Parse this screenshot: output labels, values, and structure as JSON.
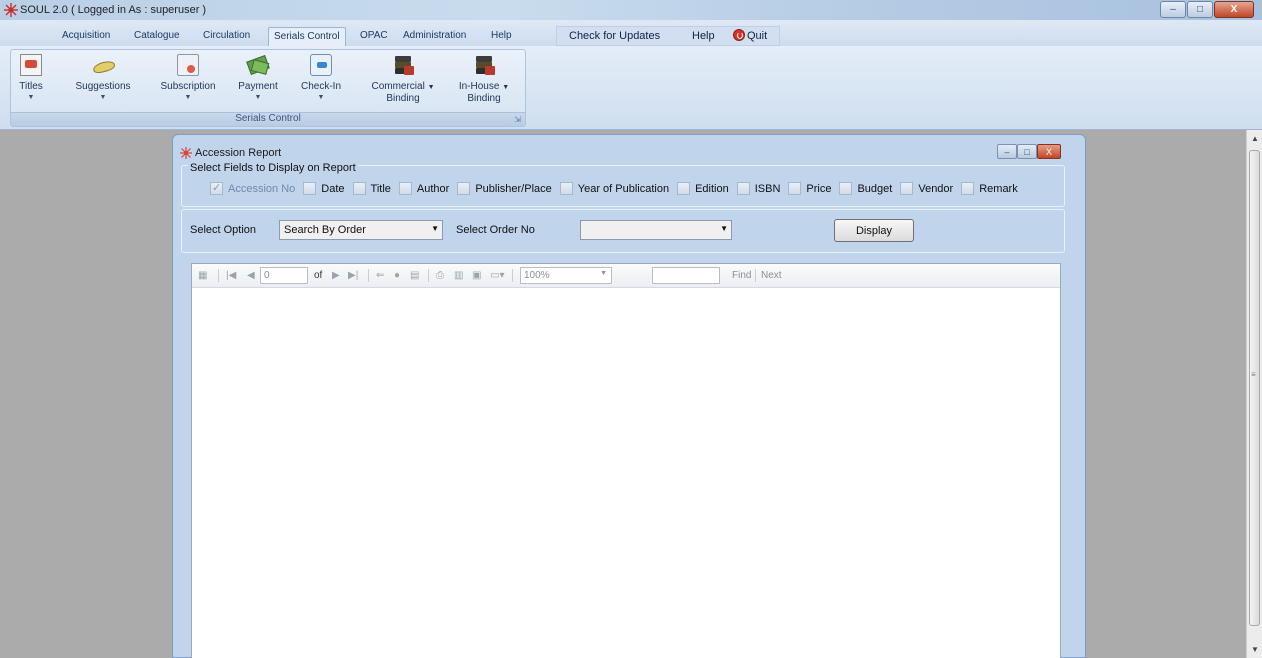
{
  "window": {
    "title": "SOUL 2.0  ( Logged in As : superuser )",
    "buttons": {
      "minimize": "–",
      "maximize": "□",
      "close": "X"
    }
  },
  "menu": {
    "tabs": [
      "Acquisition",
      "Catalogue",
      "Circulation",
      "Serials Control",
      "OPAC",
      "Administration",
      "Help"
    ],
    "active_tab": "Serials Control",
    "extra": {
      "check_updates": "Check for Updates",
      "help": "Help",
      "quit": "Quit"
    }
  },
  "ribbon": {
    "group_label": "Serials Control",
    "buttons": [
      {
        "label": "Titles",
        "sub": "",
        "icon": "titles-icon"
      },
      {
        "label": "Suggestions",
        "sub": "",
        "icon": "suggestions-icon"
      },
      {
        "label": "Subscription",
        "sub": "",
        "icon": "subscription-icon"
      },
      {
        "label": "Payment",
        "sub": "",
        "icon": "payment-icon"
      },
      {
        "label": "Check-In",
        "sub": "",
        "icon": "check-in-icon"
      },
      {
        "label": "Commercial",
        "sub": "Binding",
        "icon": "commercial-binding-icon"
      },
      {
        "label": "In-House",
        "sub": "Binding",
        "icon": "in-house-binding-icon"
      }
    ]
  },
  "child_window": {
    "title": "Accession Report",
    "fields_group_label": "Select Fields to Display on Report",
    "fields": [
      {
        "label": "Accession No",
        "checked": true
      },
      {
        "label": "Date",
        "checked": false
      },
      {
        "label": "Title",
        "checked": false
      },
      {
        "label": "Author",
        "checked": false
      },
      {
        "label": "Publisher/Place",
        "checked": false
      },
      {
        "label": "Year of Publication",
        "checked": false
      },
      {
        "label": "Edition",
        "checked": false
      },
      {
        "label": "ISBN",
        "checked": false
      },
      {
        "label": "Price",
        "checked": false
      },
      {
        "label": "Budget",
        "checked": false
      },
      {
        "label": "Vendor",
        "checked": false
      },
      {
        "label": "Remark",
        "checked": false
      }
    ],
    "select_option_label": "Select Option",
    "select_option_value": "Search By Order",
    "select_order_label": "Select Order No",
    "select_order_value": "",
    "display_button": "Display"
  },
  "report_toolbar": {
    "page_current": "0",
    "page_of": "of",
    "zoom": "100%",
    "find_value": "",
    "find": "Find",
    "next": "Next"
  }
}
